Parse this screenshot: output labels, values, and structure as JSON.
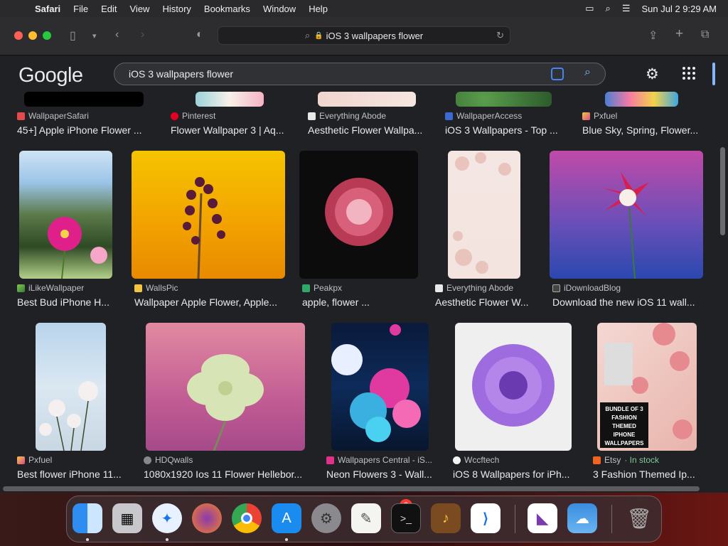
{
  "menubar": {
    "app": "Safari",
    "items": [
      "File",
      "Edit",
      "View",
      "History",
      "Bookmarks",
      "Window",
      "Help"
    ],
    "clock": "Sun Jul 2  9:29 AM"
  },
  "toolbar": {
    "address": "iOS 3 wallpapers flower"
  },
  "google": {
    "logo": "Google",
    "query": "iOS 3 wallpapers flower"
  },
  "row1": [
    {
      "source": "WallpaperSafari",
      "title": "45+] Apple iPhone Flower ..."
    },
    {
      "source": "Pinterest",
      "title": "Flower Wallpaper 3 | Aq..."
    },
    {
      "source": "Everything Abode",
      "title": "Aesthetic Flower Wallpa..."
    },
    {
      "source": "WallpaperAccess",
      "title": "iOS 3 Wallpapers - Top ..."
    },
    {
      "source": "Pxfuel",
      "title": "Blue Sky, Spring, Flower..."
    }
  ],
  "row2": [
    {
      "source": "iLikeWallpaper",
      "title": "Best Bud iPhone H..."
    },
    {
      "source": "WallsPic",
      "title": "Wallpaper Apple Flower, Apple..."
    },
    {
      "source": "Peakpx",
      "title": "apple, flower ..."
    },
    {
      "source": "Everything Abode",
      "title": "Aesthetic Flower W..."
    },
    {
      "source": "iDownloadBlog",
      "title": "Download the new iOS 11 wall..."
    }
  ],
  "row3": [
    {
      "source": "Pxfuel",
      "title": "Best flower iPhone 11..."
    },
    {
      "source": "HDQwalls",
      "title": "1080x1920 Ios 11 Flower Hellebor..."
    },
    {
      "source": "Wallpapers Central - iS...",
      "title": "Neon Flowers 3 - Wall..."
    },
    {
      "source": "Wccftech",
      "title": "iOS 8 Wallpapers for iPh..."
    },
    {
      "source": "Etsy",
      "stock": " · In stock",
      "title": "3 Fashion Themed Ip..."
    }
  ],
  "etsy_thumb_text": "BUNDLE OF 3 FASHION THEMED IPHONE WALLPAPERS",
  "dock": {
    "settings_badge": "2"
  }
}
